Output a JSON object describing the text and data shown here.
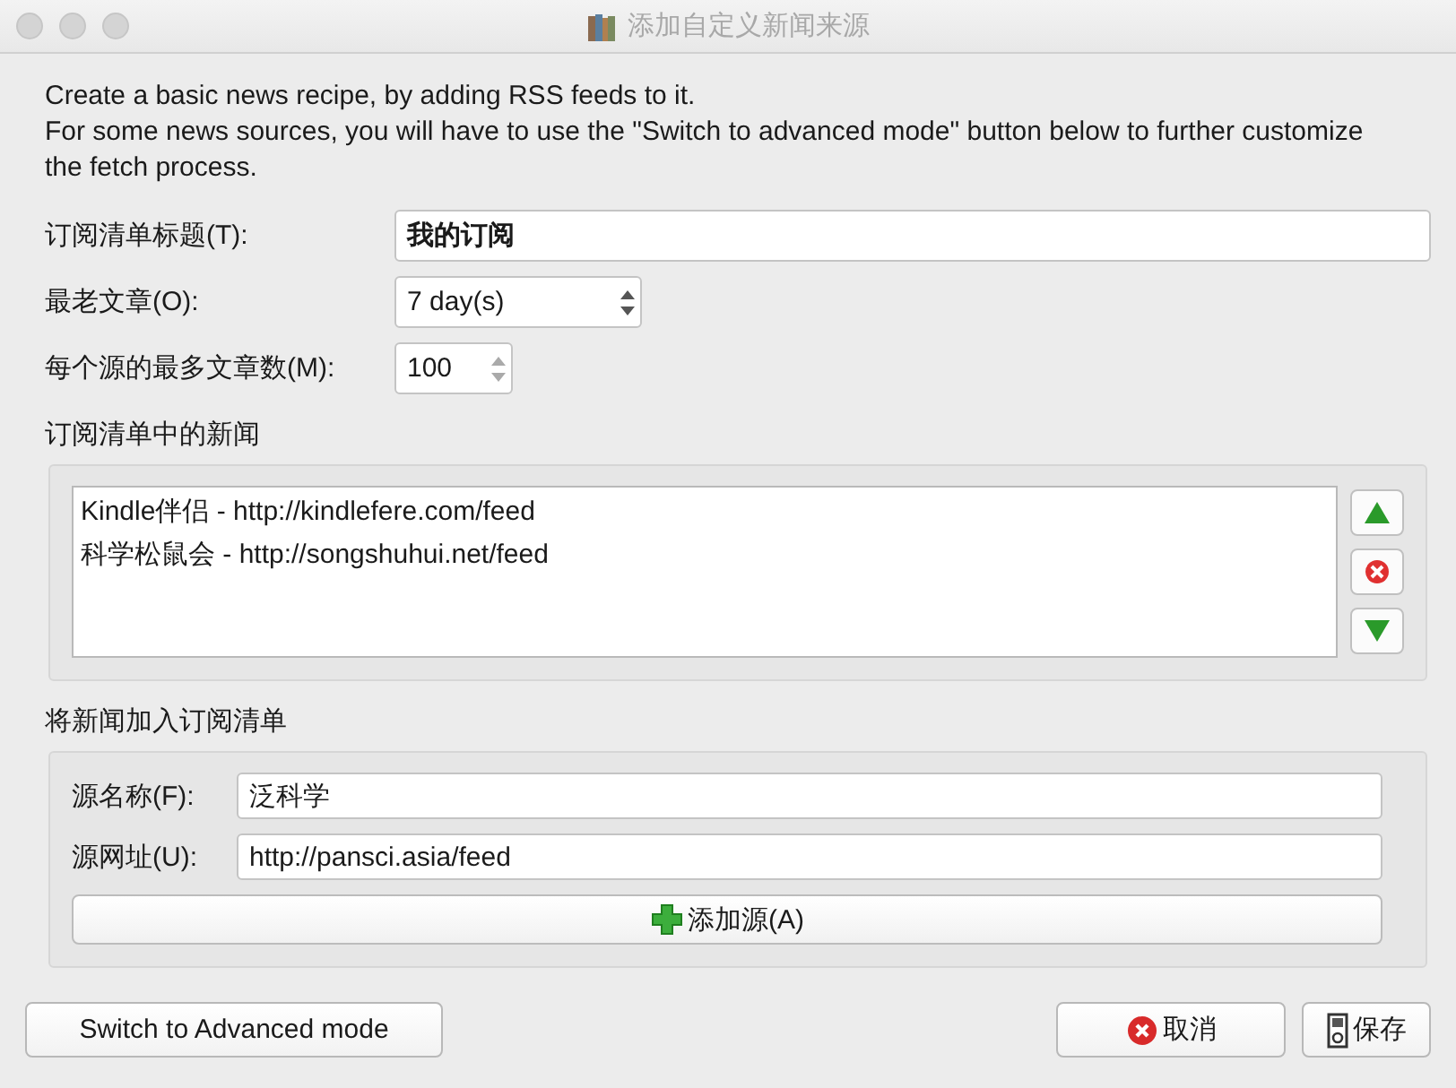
{
  "window": {
    "title": "添加自定义新闻来源"
  },
  "intro": [
    "Create a basic news recipe, by adding RSS feeds to it.",
    "For some news sources, you will have to use the \"Switch to advanced mode\" button below to further customize the fetch process."
  ],
  "fields": [
    {
      "kind": "text",
      "label": "订阅清单标题(T):",
      "value": "我的订阅"
    },
    {
      "kind": "spin",
      "label": "最老文章(O):",
      "value": "7 day(s)"
    },
    {
      "kind": "spin",
      "label": "每个源的最多文章数(M):",
      "value": "100"
    }
  ],
  "feeds": {
    "label": "订阅清单中的新闻",
    "items": [
      {
        "text": "Kindle伴侣 - http://kindlefere.com/feed",
        "selected": false
      },
      {
        "text": "科学松鼠会 - http://songshuhui.net/feed",
        "selected": false
      }
    ]
  },
  "add": {
    "label": "将新闻加入订阅清单",
    "fields": [
      {
        "label": "源名称(F):",
        "value": "泛科学"
      },
      {
        "label": "源网址(U):",
        "value": "http://pansci.asia/feed"
      }
    ],
    "button": "添加源(A)"
  },
  "buttons": [
    {
      "kind": "advanced",
      "label": "Switch to Advanced mode"
    },
    {
      "kind": "cancel",
      "label": "取消"
    },
    {
      "kind": "save",
      "label": "保存"
    }
  ]
}
